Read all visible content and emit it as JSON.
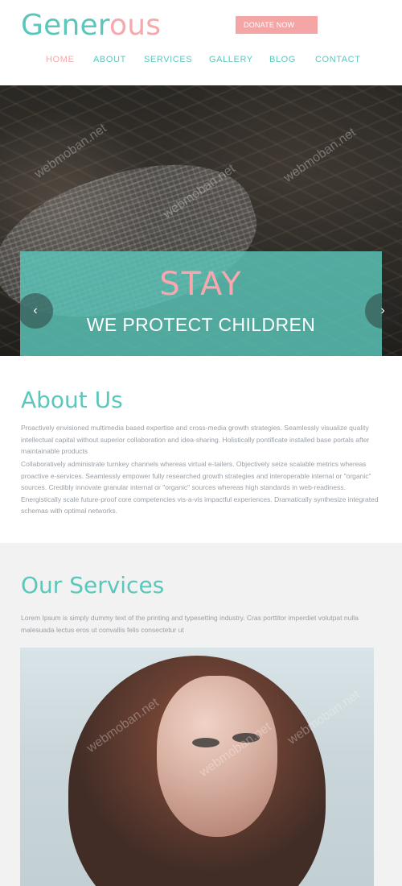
{
  "header": {
    "logo": {
      "part1": "Gener",
      "part2": "ous"
    },
    "donate_label": "DONATE NOW"
  },
  "nav": {
    "items": [
      {
        "label": "HOME",
        "active": true
      },
      {
        "label": "ABOUT",
        "active": false
      },
      {
        "label": "SERVICES",
        "active": false
      },
      {
        "label": "GALLERY",
        "active": false
      },
      {
        "label": "BLOG",
        "active": false
      },
      {
        "label": "CONTACT",
        "active": false
      }
    ]
  },
  "hero": {
    "headline": "STAY",
    "subhead": "WE PROTECT CHILDREN",
    "prev_arrow": "‹",
    "next_arrow": "›",
    "watermark": "webmoban.net"
  },
  "about": {
    "title": "About Us",
    "p1": "Proactively envisioned multimedia based expertise and cross-media growth strategies. Seamlessly visualize quality intellectual capital without superior collaboration and idea-sharing. Holistically pontificate installed base portals after maintainable products",
    "p2": "Collaboratively administrate turnkey channels whereas virtual e-tailers. Objectively seize scalable metrics whereas proactive e-services. Seamlessly empower fully researched growth strategies and interoperable internal or \"organic\" sources. Credibly innovate granular internal or \"organic\" sources whereas high standards in web-readiness. Energistically scale future-proof core competencies vis-a-vis impactful experiences. Dramatically synthesize integrated schemas with optimal networks."
  },
  "services": {
    "title": "Our Services",
    "p1": "Lorem Ipsum is simply dummy text of the printing and typesetting industry. Cras porttitor imperdiet volutpat nulla malesuada lectus eros ut convallis felis consectetur ut"
  },
  "colors": {
    "accent_teal": "#5bc7bb",
    "accent_pink": "#f6a8ad",
    "donate_bg": "#f4a5a6",
    "text_gray": "#9aa0a6",
    "services_bg": "#f2f2f2"
  }
}
